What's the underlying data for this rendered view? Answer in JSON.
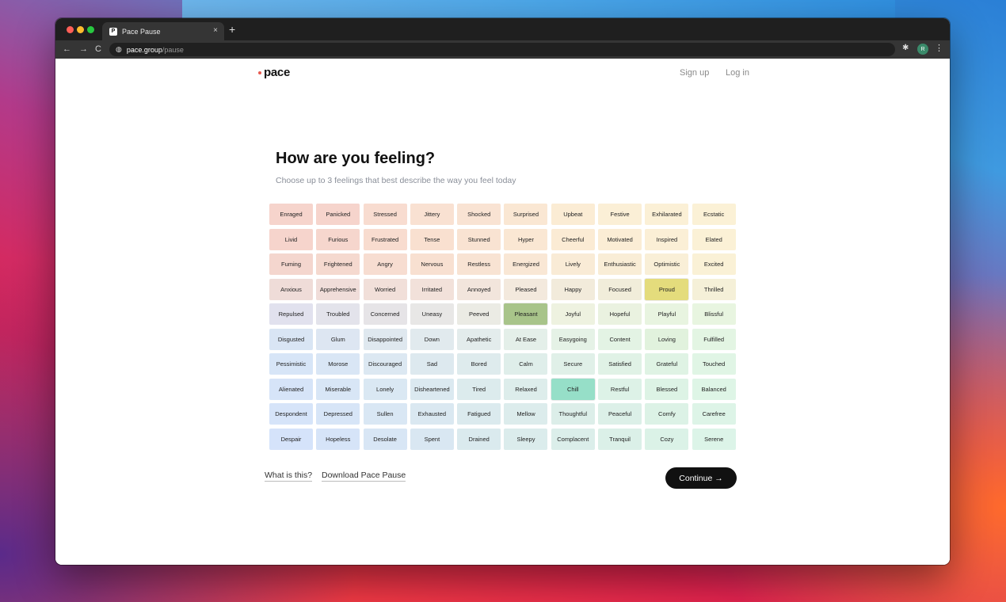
{
  "browser": {
    "tab_title": "Pace Pause",
    "favicon_text": "P",
    "tab_close": "×",
    "new_tab": "+",
    "url_host": "pace.group",
    "url_path": "/pause",
    "back": "←",
    "forward": "→",
    "reload": "C",
    "profile_initial": "R"
  },
  "header": {
    "logo": "pace",
    "sign_up": "Sign up",
    "log_in": "Log in"
  },
  "main": {
    "title": "How are you feeling?",
    "subtitle": "Choose up to 3 feelings that best describe the way you feel today"
  },
  "feelings": [
    [
      "Enraged",
      "Panicked",
      "Stressed",
      "Jittery",
      "Shocked",
      "Surprised",
      "Upbeat",
      "Festive",
      "Exhilarated",
      "Ecstatic"
    ],
    [
      "Livid",
      "Furious",
      "Frustrated",
      "Tense",
      "Stunned",
      "Hyper",
      "Cheerful",
      "Motivated",
      "Inspired",
      "Elated"
    ],
    [
      "Fuming",
      "Frightened",
      "Angry",
      "Nervous",
      "Restless",
      "Energized",
      "Lively",
      "Enthusiastic",
      "Optimistic",
      "Excited"
    ],
    [
      "Anxious",
      "Apprehensive",
      "Worried",
      "Irritated",
      "Annoyed",
      "Pleased",
      "Happy",
      "Focused",
      "Proud",
      "Thrilled"
    ],
    [
      "Repulsed",
      "Troubled",
      "Concerned",
      "Uneasy",
      "Peeved",
      "Pleasant",
      "Joyful",
      "Hopeful",
      "Playful",
      "Blissful"
    ],
    [
      "Disgusted",
      "Glum",
      "Disappointed",
      "Down",
      "Apathetic",
      "At Ease",
      "Easygoing",
      "Content",
      "Loving",
      "Fulfilled"
    ],
    [
      "Pessimistic",
      "Morose",
      "Discouraged",
      "Sad",
      "Bored",
      "Calm",
      "Secure",
      "Satisfied",
      "Grateful",
      "Touched"
    ],
    [
      "Alienated",
      "Miserable",
      "Lonely",
      "Disheartened",
      "Tired",
      "Relaxed",
      "Chill",
      "Restful",
      "Blessed",
      "Balanced"
    ],
    [
      "Despondent",
      "Depressed",
      "Sullen",
      "Exhausted",
      "Fatigued",
      "Mellow",
      "Thoughtful",
      "Peaceful",
      "Comfy",
      "Carefree"
    ],
    [
      "Despair",
      "Hopeless",
      "Desolate",
      "Spent",
      "Drained",
      "Sleepy",
      "Complacent",
      "Tranquil",
      "Cozy",
      "Serene"
    ]
  ],
  "colors": [
    [
      "#f6d4cc",
      "#f6d4cc",
      "#f8dcd0",
      "#f9e1d2",
      "#f9e3d3",
      "#fae7d3",
      "#fbecd4",
      "#fbefd6",
      "#fbf0d6",
      "#fbf1d6"
    ],
    [
      "#f6d4cc",
      "#f6d6cd",
      "#f8dccf",
      "#f9e0d0",
      "#f9e3d2",
      "#fae7d3",
      "#fbebd4",
      "#fbedd5",
      "#fbefd6",
      "#fbf1d6"
    ],
    [
      "#f4d6ce",
      "#f5d9cf",
      "#f7ddd1",
      "#f8e0d1",
      "#f8e3d3",
      "#f9e7d5",
      "#f9ebd6",
      "#f9edd6",
      "#f9efd7",
      "#faf1d6"
    ],
    [
      "#efdcd8",
      "#f0ddd9",
      "#f1dfd9",
      "#f2e1da",
      "#f2e5dc",
      "#f3e9dd",
      "#f2ebdb",
      "#f1edda",
      "#e4dc7c",
      "#f5f0d8"
    ],
    [
      "#e1e1ee",
      "#e3e3eb",
      "#e6e4e7",
      "#e8e7e6",
      "#ebebe4",
      "#a8c48a",
      "#eef2e0",
      "#eaf2e0",
      "#e8f4e0",
      "#e8f5e0"
    ],
    [
      "#d9e5f4",
      "#dde6f2",
      "#dfe8ef",
      "#e1eaee",
      "#e3ecec",
      "#e4efe9",
      "#e5f2e6",
      "#e3f3e4",
      "#e1f2dd",
      "#e3f5e3"
    ],
    [
      "#d7e5f7",
      "#d9e6f5",
      "#dce8f2",
      "#dde9ef",
      "#deebed",
      "#dfeeea",
      "#e0f0e8",
      "#e0f2e6",
      "#dff3e4",
      "#e0f5e5"
    ],
    [
      "#d6e4f8",
      "#d8e6f6",
      "#dae8f3",
      "#dbe9f0",
      "#dcebed",
      "#ddedeb",
      "#96dfc8",
      "#ddf2e7",
      "#ddf3e5",
      "#def5e6"
    ],
    [
      "#d6e4f9",
      "#d7e5f7",
      "#d9e7f4",
      "#dae8f1",
      "#dbeaee",
      "#dcecec",
      "#dceee9",
      "#dcf0e8",
      "#dcf2e6",
      "#ddf4e7"
    ],
    [
      "#d5e3fa",
      "#d6e4f8",
      "#d8e6f5",
      "#d9e7f2",
      "#daeaee",
      "#dbecec",
      "#dbeeea",
      "#dbf0e8",
      "#dbf2e7",
      "#dcf4e8"
    ]
  ],
  "selected": [
    "Proud",
    "Pleasant",
    "Chill"
  ],
  "footer": {
    "what_is_this": "What is this?",
    "download": "Download Pace Pause",
    "continue": "Continue →"
  }
}
